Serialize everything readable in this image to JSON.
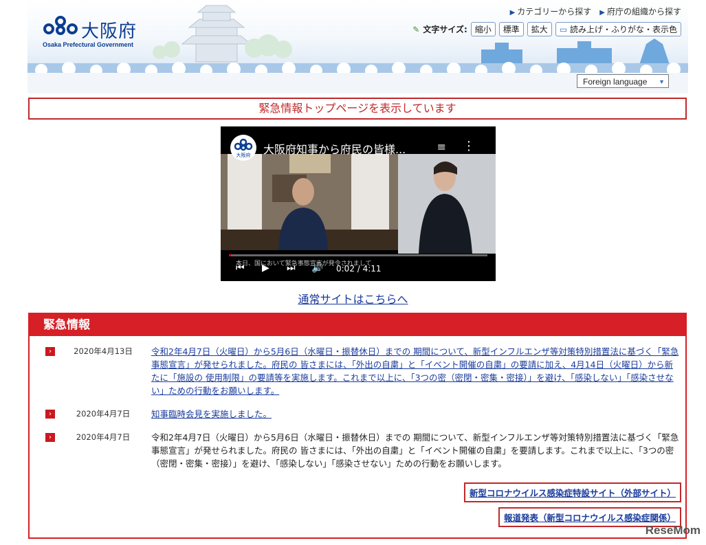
{
  "header": {
    "logo_name": "大阪府",
    "logo_sub": "Osaka Prefectural Government",
    "top_links": [
      "カテゴリーから探す",
      "府庁の組織から探す"
    ],
    "font_size_label": "文字サイズ:",
    "font_buttons": [
      "縮小",
      "標準",
      "拡大"
    ],
    "reader_button": "読み上げ・ふりがな・表示色",
    "language_select": "Foreign language"
  },
  "notice": "緊急情報トップページを表示しています",
  "video": {
    "badge": "大阪府",
    "title": "大阪府知事から府民の皆様...",
    "subtitle": "本日、国において緊急事態宣言が発令されまして",
    "time": "0:02 / 4:11",
    "progress": 0.008
  },
  "normal_site_link": "通常サイトはこちらへ",
  "emergency": {
    "heading": "緊急情報",
    "items": [
      {
        "date": "2020年4月13日",
        "text": "令和2年4月7日（火曜日）から5月6日（水曜日・振替休日）までの 期間について、新型インフルエンザ等対策特別措置法に基づく「緊急事態宣言」が発せられました。府民の 皆さまには、「外出の自粛」と「イベント開催の自粛」の要請に加え、4月14日（火曜日）から新たに「施設の 使用制限」の要請等を実施します。これまで以上に、「3つの密（密閉・密集・密接）」を避け、「感染しない」「感染させない」ための行動をお願いします。",
        "link": true
      },
      {
        "date": "2020年4月7日",
        "text": "知事臨時会見を実施しました。",
        "link": true
      },
      {
        "date": "2020年4月7日",
        "text": "令和2年4月7日（火曜日）から5月6日（水曜日・振替休日）までの 期間について、新型インフルエンザ等対策特別措置法に基づく「緊急事態宣言」が発せられました。府民の 皆さまには、「外出の自粛」と「イベント開催の自粛」を要請します。これまで以上に、「3つの密（密閉・密集・密接）」を避け、「感染しない」「感染させない」ための行動をお願いします。",
        "link": false
      }
    ],
    "buttons": [
      "新型コロナウイルス感染症特設サイト（外部サイト）",
      "報道発表（新型コロナウイルス感染症関係）"
    ]
  },
  "watermark": "ReseMom",
  "colors": {
    "accent_red": "#d61f26",
    "link_blue": "#1a3b9c",
    "logo_blue": "#0b3d91"
  }
}
